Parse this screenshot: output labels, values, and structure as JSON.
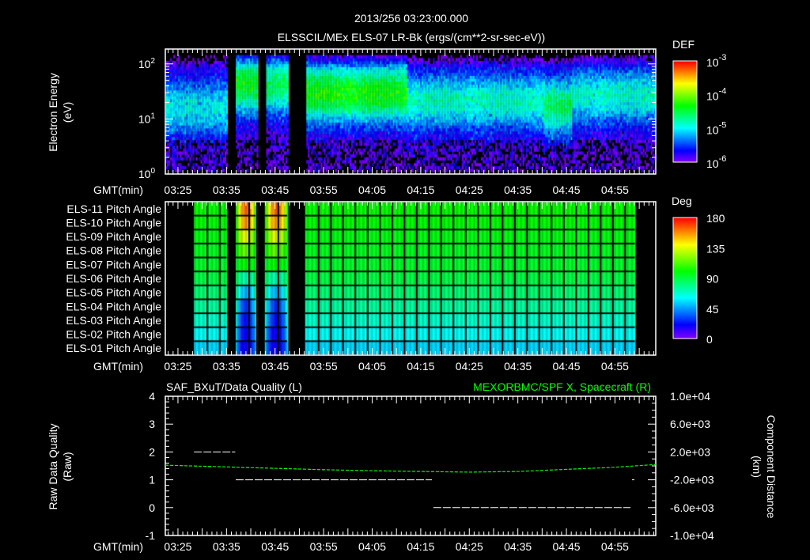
{
  "header": {
    "timestamp": "2013/256 03:23:00.000",
    "title": "ELSSCIL/MEx ELS-07 LR-Bk  (ergs/(cm**2-sr-sec-eV))"
  },
  "time_axis": {
    "label": "GMT(min)",
    "ticks": [
      "03:25",
      "03:35",
      "03:45",
      "03:55",
      "04:05",
      "04:15",
      "04:25",
      "04:35",
      "04:45",
      "04:55"
    ],
    "tick_minutes": [
      205,
      215,
      225,
      235,
      245,
      255,
      265,
      275,
      285,
      295
    ],
    "range_minutes": [
      202.4,
      303.4
    ]
  },
  "colors": {
    "background": "#000000",
    "axis": "#ffffff",
    "x_component": "#00ff00",
    "quality": "#ffffff"
  },
  "chart_data": [
    {
      "type": "heatmap",
      "name": "energy-spectrogram",
      "ylabel": "Electron Energy",
      "yunits": "(eV)",
      "yscale": "log",
      "ylim": [
        1,
        186
      ],
      "yticks": [
        {
          "base": "10",
          "exp": "0",
          "value": 1
        },
        {
          "base": "10",
          "exp": "1",
          "value": 10
        },
        {
          "base": "10",
          "exp": "2",
          "value": 100
        }
      ],
      "colorbar": {
        "title": "DEF",
        "scale": "log",
        "range": [
          1e-06,
          0.001
        ],
        "ticks": [
          {
            "base": "10",
            "exp": "-3",
            "value": -3
          },
          {
            "base": "10",
            "exp": "-4",
            "value": -4
          },
          {
            "base": "10",
            "exp": "-5",
            "value": -5
          },
          {
            "base": "10",
            "exp": "-6",
            "value": -6
          }
        ]
      },
      "data_gaps_minutes": [
        [
          215.0,
          216.9
        ],
        [
          221.3,
          222.9
        ],
        [
          227.5,
          231.2
        ]
      ],
      "regimes": [
        {
          "start": 202.4,
          "end": 215.0,
          "peak_eV": 15,
          "peak_log_def": -5.0
        },
        {
          "start": 216.9,
          "end": 221.3,
          "peak_eV": 40,
          "peak_log_def": -4.4
        },
        {
          "start": 222.9,
          "end": 227.5,
          "peak_eV": 40,
          "peak_log_def": -4.6
        },
        {
          "start": 231.2,
          "end": 252.0,
          "peak_eV": 28,
          "peak_log_def": -4.3
        },
        {
          "start": 252.0,
          "end": 280.0,
          "peak_eV": 20,
          "peak_log_def": -4.85
        },
        {
          "start": 280.0,
          "end": 286.0,
          "peak_eV": 16,
          "peak_log_def": -4.6
        },
        {
          "start": 286.0,
          "end": 303.4,
          "peak_eV": 25,
          "peak_log_def": -4.9
        }
      ]
    },
    {
      "type": "heatmap",
      "name": "pitch-angle",
      "colorbar": {
        "title": "Deg",
        "range": [
          0,
          180
        ],
        "ticks": [
          "180",
          "135",
          "90",
          "45",
          "0"
        ],
        "tick_values": [
          180,
          135,
          90,
          45,
          0
        ]
      },
      "rows": [
        {
          "label": "ELS-11 Pitch Angle",
          "background_deg": 101,
          "anomaly_deg": 168
        },
        {
          "label": "ELS-10 Pitch Angle",
          "background_deg": 99,
          "anomaly_deg": 160
        },
        {
          "label": "ELS-09 Pitch Angle",
          "background_deg": 97,
          "anomaly_deg": 140
        },
        {
          "label": "ELS-08 Pitch Angle",
          "background_deg": 95,
          "anomaly_deg": 118
        },
        {
          "label": "ELS-07 Pitch Angle",
          "background_deg": 93,
          "anomaly_deg": 100
        },
        {
          "label": "ELS-06 Pitch Angle",
          "background_deg": 89,
          "anomaly_deg": 70
        },
        {
          "label": "ELS-05 Pitch Angle",
          "background_deg": 82,
          "anomaly_deg": 45
        },
        {
          "label": "ELS-04 Pitch Angle",
          "background_deg": 75,
          "anomaly_deg": 25
        },
        {
          "label": "ELS-03 Pitch Angle",
          "background_deg": 68,
          "anomaly_deg": 18
        },
        {
          "label": "ELS-02 Pitch Angle",
          "background_deg": 61,
          "anomaly_deg": 14
        },
        {
          "label": "ELS-01 Pitch Angle",
          "background_deg": 54,
          "anomaly_deg": 12
        }
      ],
      "data_intervals_minutes": [
        [
          208.3,
          215.0
        ],
        [
          216.9,
          221.0
        ],
        [
          222.9,
          227.5
        ],
        [
          231.2,
          299.1
        ]
      ],
      "anomaly_intervals_minutes": [
        [
          216.9,
          221.0
        ],
        [
          222.9,
          227.5
        ]
      ]
    },
    {
      "type": "line",
      "name": "data-quality-and-x-component",
      "left_title": "SAF_BXuT/Data Quality (L)",
      "right_title": "MEXORBMC/SPF X, Spacecraft (R)",
      "ylabel_left": "Raw Data Quality",
      "yunits_left": "(Raw)",
      "ylim_left": [
        -1,
        4
      ],
      "yticks_left": [
        "-1",
        "0",
        "1",
        "2",
        "3",
        "4"
      ],
      "ylabel_right": "Component Distance",
      "yunits_right": "(km)",
      "ylim_right": [
        -10000,
        10000
      ],
      "yticks_right": [
        "-1.0e+04",
        "-6.0e+03",
        "-2.0e+03",
        "2.0e+03",
        "6.0e+03",
        "1.0e+04"
      ],
      "quality_segments": [
        {
          "start": 208.3,
          "end": 216.8,
          "value": 2
        },
        {
          "start": 216.9,
          "end": 257.3,
          "value": 1
        },
        {
          "start": 257.6,
          "end": 298.2,
          "value": 0
        },
        {
          "start": 298.5,
          "end": 299.0,
          "value": 1
        }
      ],
      "x_component_km": {
        "x": [
          202.4,
          215,
          225,
          235,
          245,
          255,
          265,
          275,
          285,
          295,
          303.4
        ],
        "y": [
          100,
          -150,
          -350,
          -550,
          -700,
          -800,
          -900,
          -800,
          -500,
          -200,
          200
        ]
      }
    }
  ]
}
